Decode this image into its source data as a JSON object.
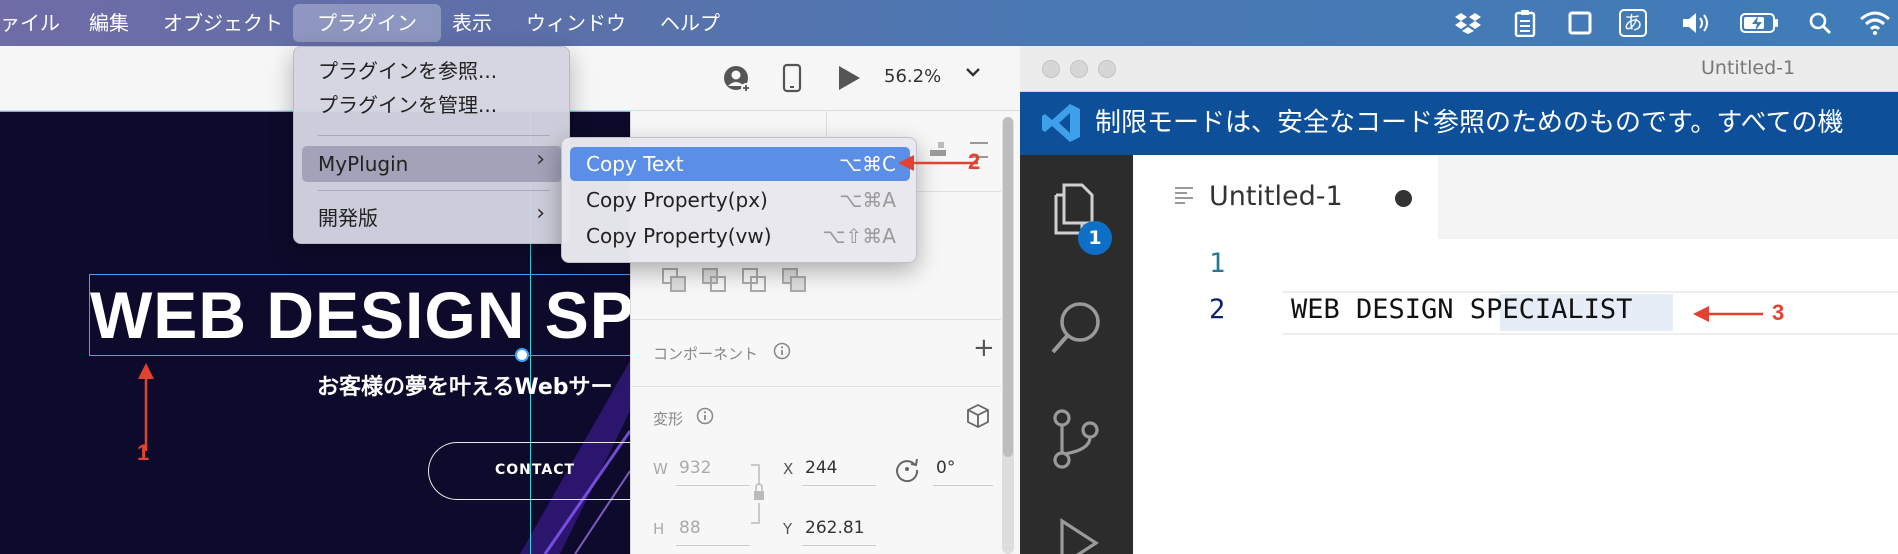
{
  "menubar": {
    "items": [
      "ァイル",
      "編集",
      "オブジェクト",
      "プラグイン",
      "表示",
      "ウィンドウ",
      "ヘルプ"
    ],
    "active_index": 3,
    "status_icons": [
      "dropbox-icon",
      "clipboard-icon",
      "window-icon",
      "input-method-icon",
      "volume-icon",
      "battery-icon",
      "search-icon",
      "wifi-icon"
    ],
    "input_method_label": "あ"
  },
  "xd": {
    "zoom": "56.2%",
    "canvas": {
      "headline": "WEB DESIGN SP",
      "subtitle": "お客様の夢を叶えるWebサー",
      "contact_button": "CONTACT"
    },
    "inspector": {
      "component_label": "コンポーネント",
      "transform_label": "変形",
      "w_label": "W",
      "w_value": "932",
      "h_label": "H",
      "h_value": "88",
      "x_label": "X",
      "x_value": "244",
      "y_label": "Y",
      "y_value": "262.81",
      "rotation": "0°"
    }
  },
  "plugin_menu": {
    "items": [
      "プラグインを参照...",
      "プラグインを管理...",
      "MyPlugin",
      "開発版"
    ]
  },
  "submenu": {
    "items": [
      {
        "label": "Copy Text",
        "shortcut": "⌥⌘C"
      },
      {
        "label": "Copy Property(px)",
        "shortcut": "⌥⌘A"
      },
      {
        "label": "Copy Property(vw)",
        "shortcut": "⌥⇧⌘A"
      }
    ]
  },
  "vscode": {
    "window_title": "Untitled-1",
    "banner": "制限モードは、安全なコード参照のためのものです。すべての機",
    "tab_label": "Untitled-1",
    "explorer_badge": "1",
    "line_numbers": [
      "1",
      "2"
    ],
    "code_line_2": "WEB DESIGN SPECIALIST"
  },
  "annotations": [
    "1",
    "2",
    "3"
  ],
  "colors": {
    "menubar_start": "#6f6ca6",
    "menubar_end": "#3f7cb8",
    "menu_selected": "#5b8ee6",
    "canvas_bg": "#0d0a2b",
    "vscode_banner": "#0e4f99",
    "annotation_red": "#e24330"
  }
}
